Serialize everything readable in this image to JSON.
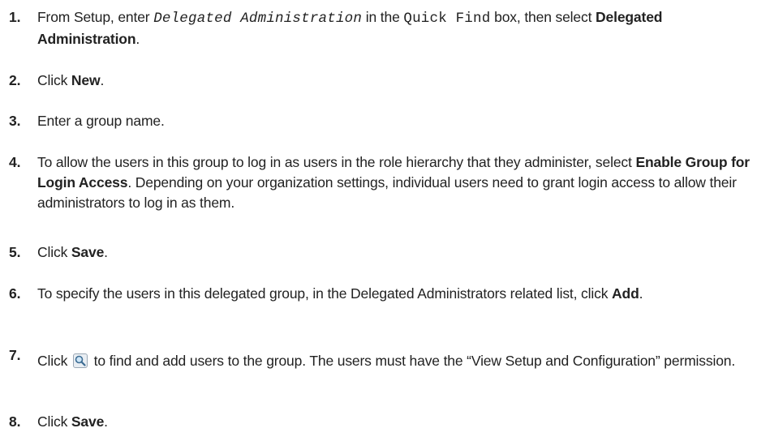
{
  "steps": [
    {
      "number": "1.",
      "p1": "From Setup, enter ",
      "code1": "Delegated Administration",
      "p2": " in the ",
      "code2": "Quick Find",
      "p3": " box, then select ",
      "b1": "Delegated Administration",
      "p4": "."
    },
    {
      "number": "2.",
      "p1": "Click ",
      "b1": "New",
      "p2": "."
    },
    {
      "number": "3.",
      "p1": "Enter a group name."
    },
    {
      "number": "4.",
      "p1": "To allow the users in this group to log in as users in the role hierarchy that they administer, select ",
      "b1": "Enable Group for Login Access",
      "p2": ". Depending on your organization settings, individual users need to grant login access to allow their administrators to log in as them."
    },
    {
      "number": "5.",
      "p1": "Click ",
      "b1": "Save",
      "p2": "."
    },
    {
      "number": "6.",
      "p1": "To specify the users in this delegated group, in the Delegated Administrators related list, click ",
      "b1": "Add",
      "p2": "."
    },
    {
      "number": "7.",
      "p1": "Click ",
      "icon": "lookup-magnifier-icon",
      "p2": " to find and add users to the group. The users must have the “View Setup and Configuration” permission."
    },
    {
      "number": "8.",
      "p1": "Click ",
      "b1": "Save",
      "p2": "."
    }
  ]
}
